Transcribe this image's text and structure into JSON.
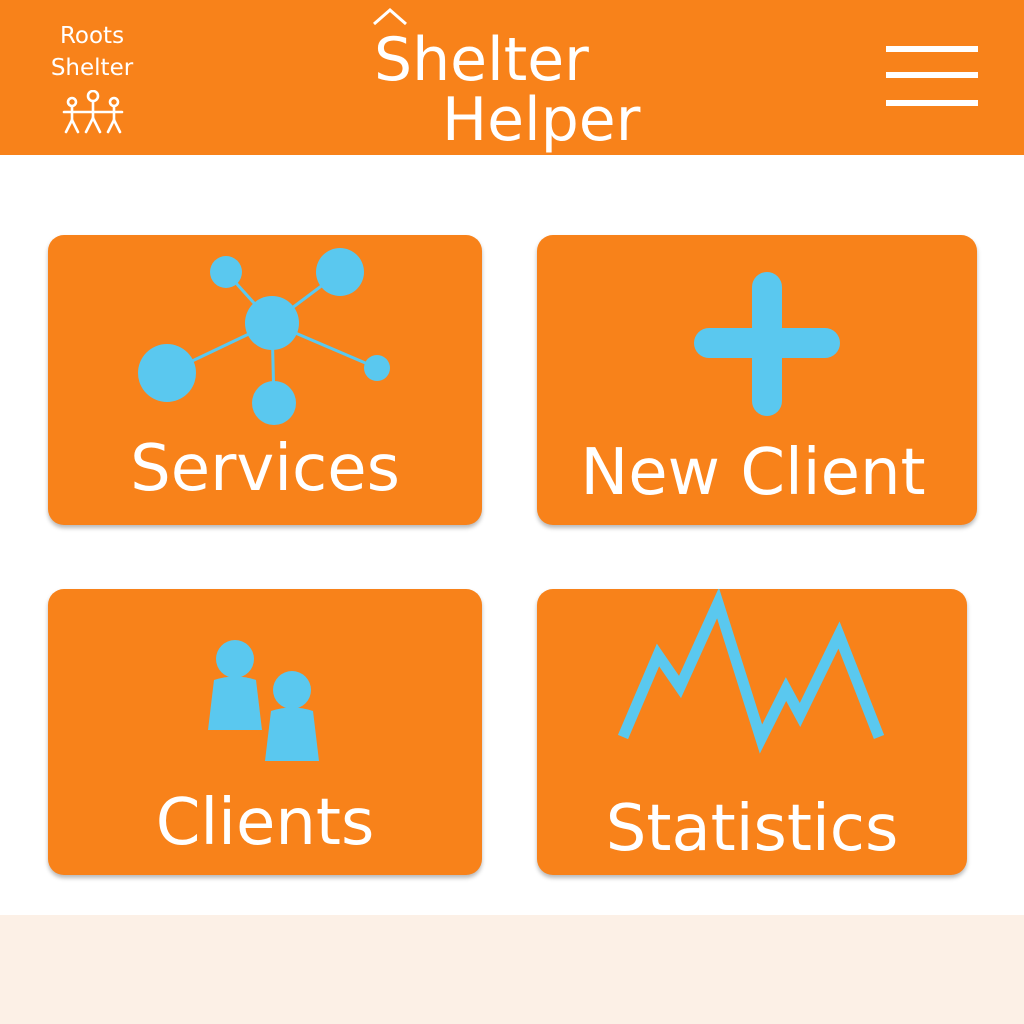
{
  "colors": {
    "brand_orange": "#f8821a",
    "icon_blue": "#5ac8ef",
    "white": "#ffffff",
    "footer_bg": "#fcf0e6"
  },
  "header": {
    "org_name_line1": "Roots",
    "org_name_line2": "Shelter",
    "org_logo_icon": "family-figures-icon",
    "app_title_line1": "Shelter",
    "app_title_line2": "Helper",
    "menu_icon": "hamburger-menu-icon"
  },
  "tiles": [
    {
      "label": "Services",
      "icon": "network-icon"
    },
    {
      "label": "New Client",
      "icon": "plus-icon"
    },
    {
      "label": "Clients",
      "icon": "people-icon"
    },
    {
      "label": "Statistics",
      "icon": "line-chart-icon"
    }
  ]
}
